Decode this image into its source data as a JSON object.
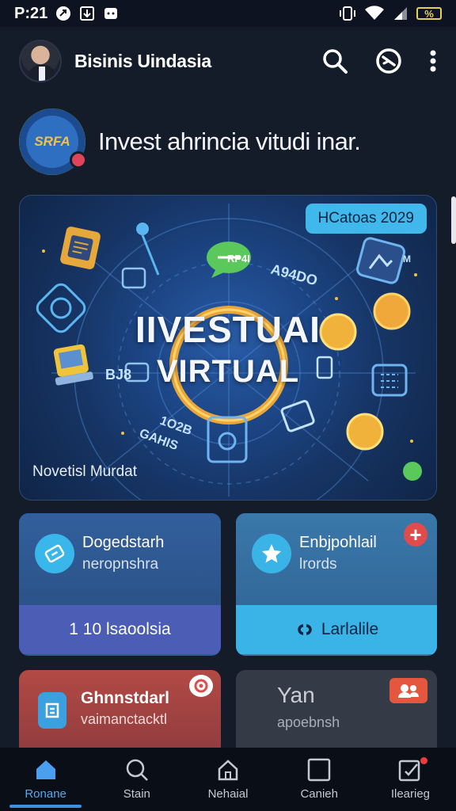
{
  "status_bar": {
    "time": "P:21",
    "battery_text": "%"
  },
  "header": {
    "title": "Bisinis Uindasia"
  },
  "intro": {
    "logo_text": "SRFA",
    "text": "Invest ahrincia vitudi inar."
  },
  "hero": {
    "tag": "HCatoas 2029",
    "headline_1": "IIVESTUAI",
    "headline_2": "VIRTUAL",
    "caption": "Novetisl Murdat",
    "labels": [
      "RP4I",
      "A94DO",
      "BJ8",
      "1O2B",
      "GAHIS",
      "M"
    ]
  },
  "cards": [
    {
      "title": "Dogedstarh",
      "subtitle": "neropnshra",
      "footer": "1 10 lsaoolsia"
    },
    {
      "title": "Enbjpohlail",
      "subtitle": "lrords",
      "footer": "Larlalile",
      "badge": "+"
    },
    {
      "title": "Ghnnstdarl",
      "subtitle": "vaimanctacktl"
    },
    {
      "title": "Yan",
      "subtitle": "apoebnsh"
    }
  ],
  "nav": {
    "items": [
      {
        "label": "Ronane",
        "icon": "home-icon"
      },
      {
        "label": "Stain",
        "icon": "search-icon"
      },
      {
        "label": "Nehaial",
        "icon": "house-outline-icon"
      },
      {
        "label": "Canieh",
        "icon": "square-icon"
      },
      {
        "label": "Ilearieg",
        "icon": "edit-icon"
      }
    ]
  },
  "colors": {
    "background": "#141c2a",
    "accent": "#3d8fe0",
    "tag_bg": "#41b8ec",
    "card_red": "#b24a44"
  }
}
